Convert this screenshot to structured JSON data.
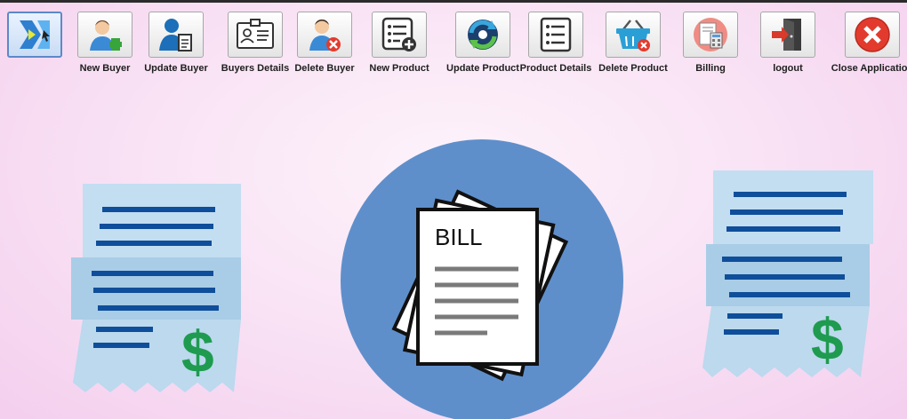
{
  "toolbar": {
    "items": [
      {
        "label": "",
        "icon": "app-logo-icon"
      },
      {
        "label": "New Buyer",
        "icon": "add-user-icon"
      },
      {
        "label": "Update Buyer",
        "icon": "edit-user-icon"
      },
      {
        "label": "Buyers Details",
        "icon": "id-card-icon"
      },
      {
        "label": "Delete Buyer",
        "icon": "remove-user-icon"
      },
      {
        "label": "New Product",
        "icon": "add-list-icon"
      },
      {
        "label": "Update Product",
        "icon": "refresh-icon"
      },
      {
        "label": "Product Details",
        "icon": "list-icon"
      },
      {
        "label": "Delete Product",
        "icon": "basket-delete-icon"
      },
      {
        "label": "Billing",
        "icon": "calculator-icon"
      },
      {
        "label": "logout",
        "icon": "logout-door-icon"
      },
      {
        "label": "Close Application",
        "icon": "close-circle-icon"
      }
    ]
  },
  "illustration": {
    "bill_heading": "BILL",
    "currency_symbol": "$"
  },
  "colors": {
    "circle": "#5f8fcb",
    "receipt": "#bcd9ee",
    "receipt_lines": "#0f4e9a",
    "dollar": "#1e9b4f",
    "close_red": "#e23b2e"
  }
}
